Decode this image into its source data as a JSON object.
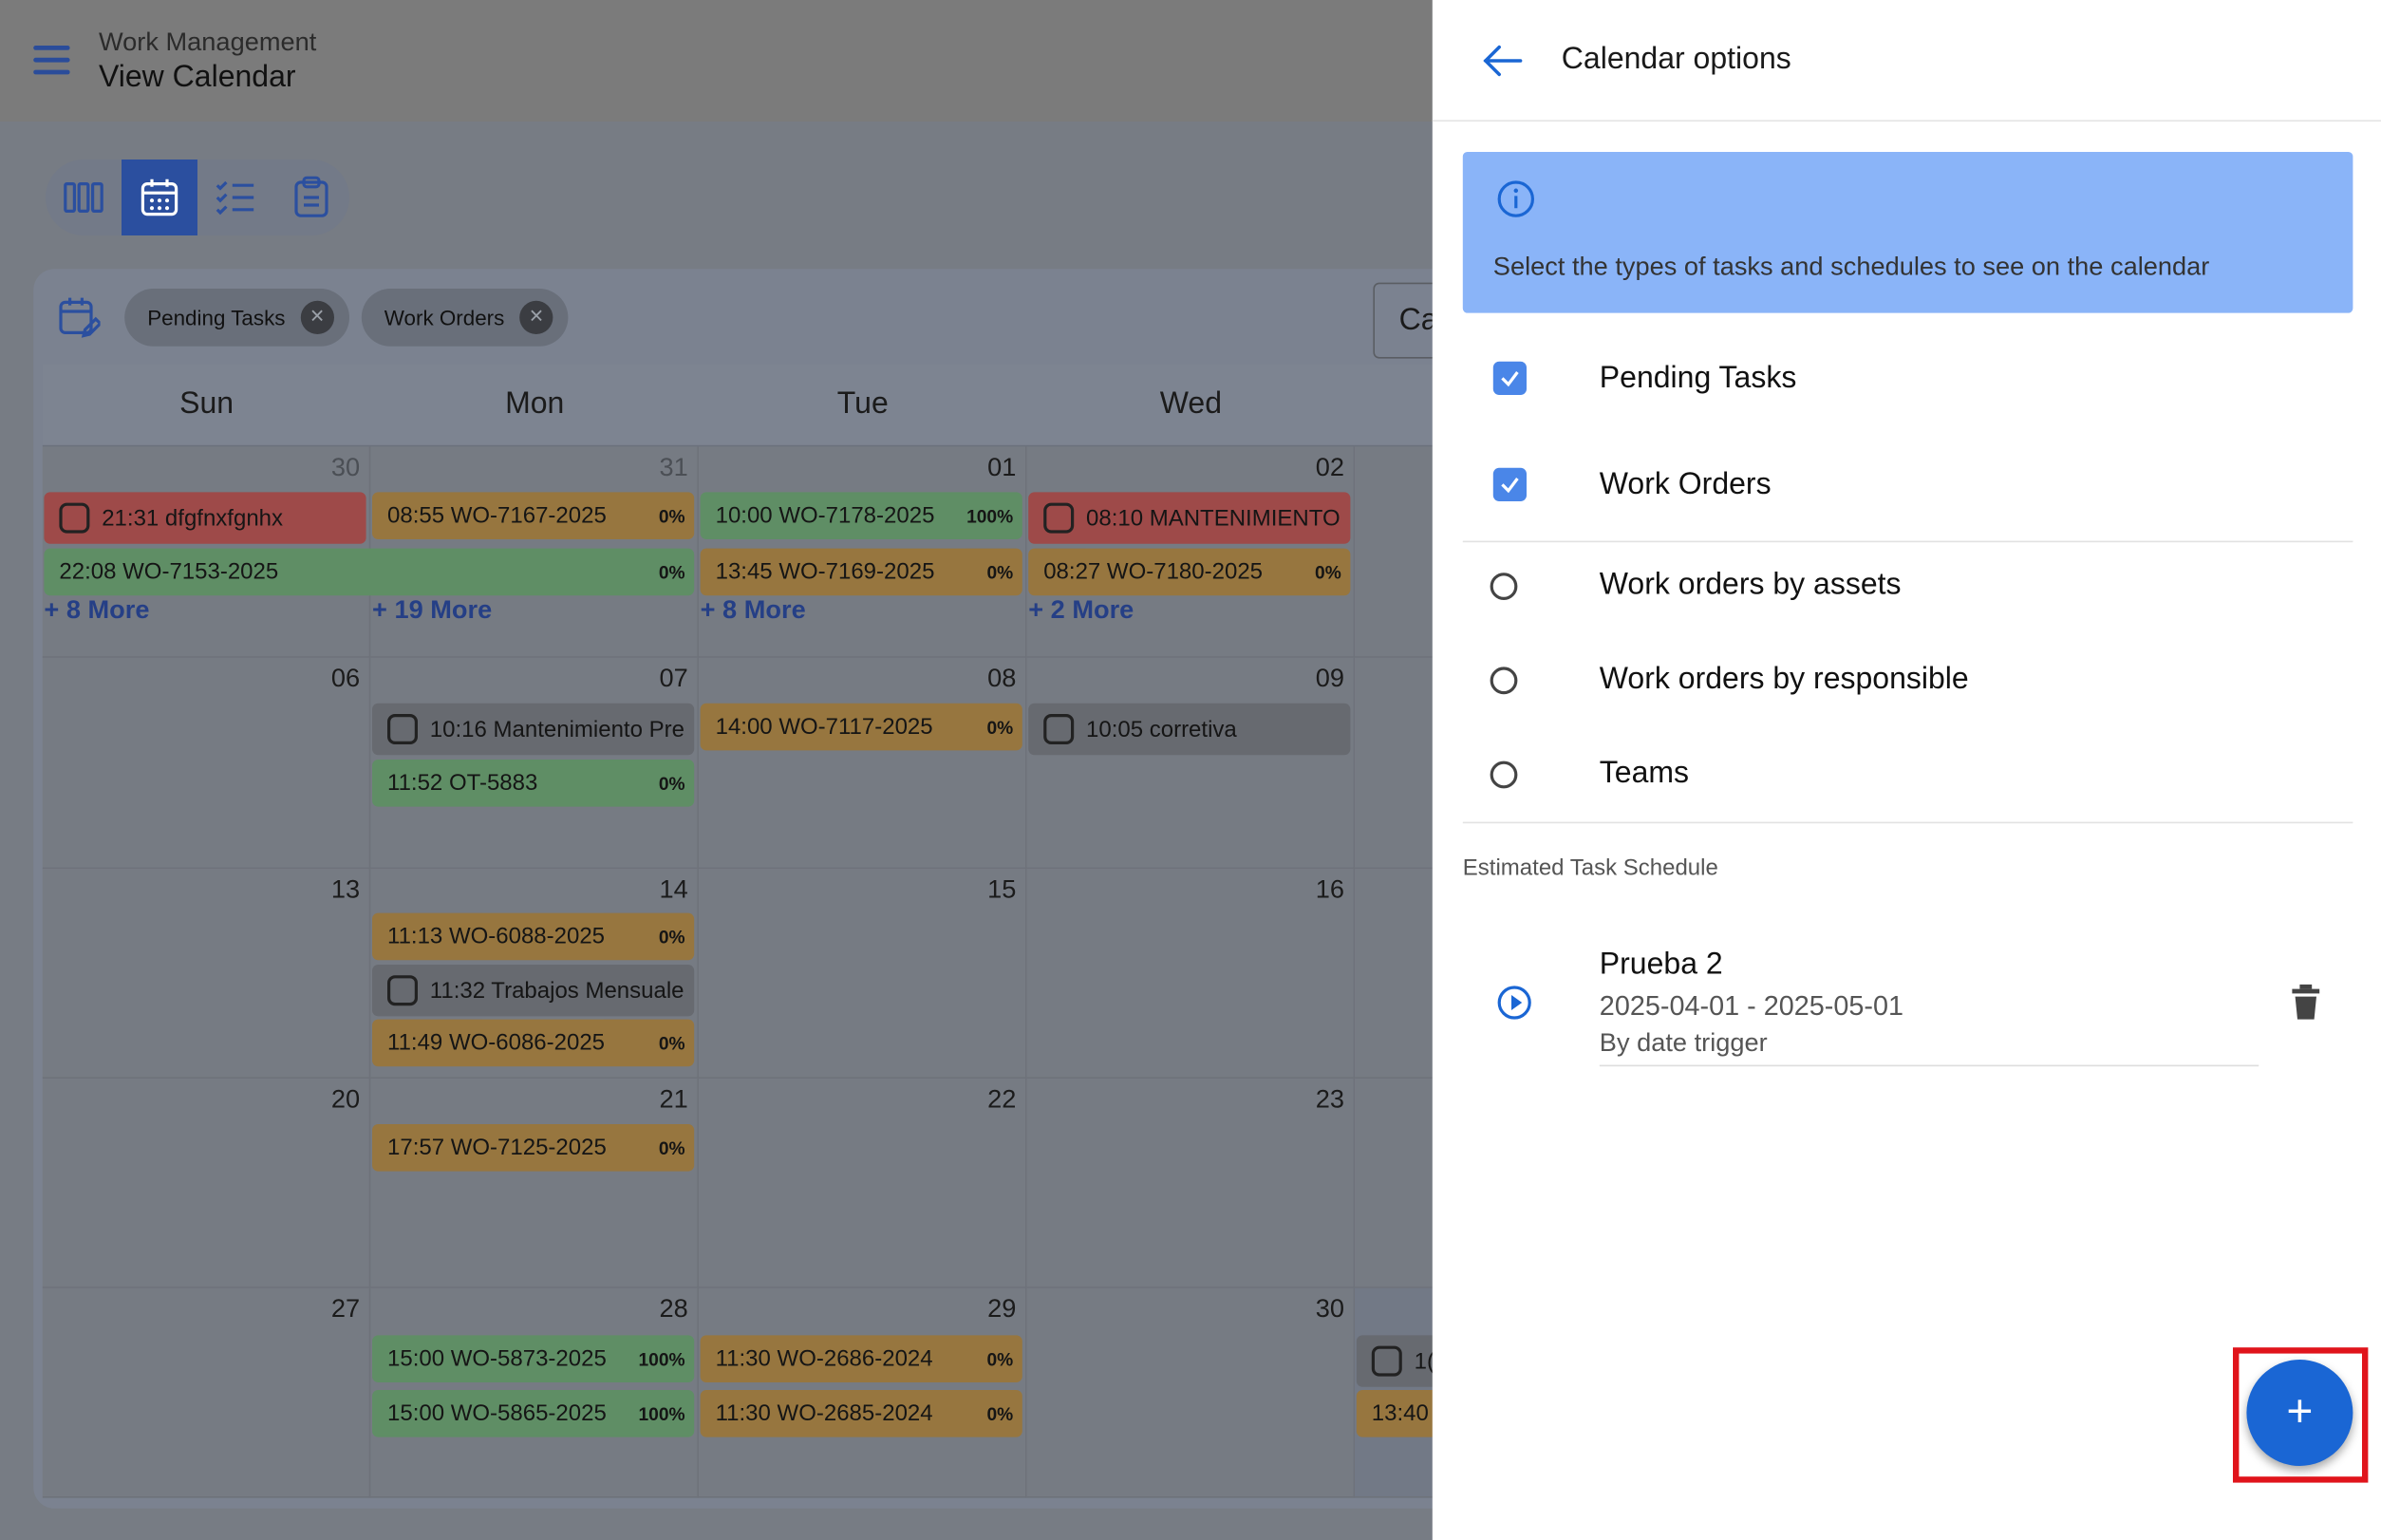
{
  "header": {
    "app": "Work Management",
    "page": "View Calendar"
  },
  "filters": {
    "chips": [
      "Pending Tasks",
      "Work Orders"
    ],
    "partial_button": "Ca"
  },
  "calendar": {
    "days": [
      "Sun",
      "Mon",
      "Tue",
      "Wed"
    ],
    "weeks": [
      [
        "30",
        "31",
        "01",
        "02"
      ],
      [
        "06",
        "07",
        "08",
        "09"
      ],
      [
        "13",
        "14",
        "15",
        "16"
      ],
      [
        "20",
        "21",
        "22",
        "23"
      ],
      [
        "27",
        "28",
        "29",
        "30"
      ]
    ],
    "events": {
      "w0_sun": {
        "e1": "21:31 dfgfnxfgnhx",
        "e2": "22:08 WO-7153-2025",
        "e2p": "0%",
        "more": "+ 8 More"
      },
      "w0_mon": {
        "e1": "08:55 WO-7167-2025",
        "e1p": "0%",
        "more": "+ 19 More"
      },
      "w0_tue": {
        "e1": "10:00 WO-7178-2025",
        "e1p": "100%",
        "e2": "13:45 WO-7169-2025",
        "e2p": "0%",
        "more": "+ 8 More"
      },
      "w0_wed": {
        "e1": "08:10 MANTENIMIENTO",
        "e2": "08:27 WO-7180-2025",
        "e2p": "0%",
        "more": "+ 2 More"
      },
      "w1_mon": {
        "e1": "10:16 Mantenimiento Pre",
        "e2": "11:52 OT-5883",
        "e2p": "0%"
      },
      "w1_tue": {
        "e1": "14:00 WO-7117-2025",
        "e1p": "0%"
      },
      "w1_wed": {
        "e1": "10:05 corretiva"
      },
      "w2_mon": {
        "e1": "11:13 WO-6088-2025",
        "e1p": "0%",
        "e2": "11:32 Trabajos Mensuale",
        "e3": "11:49 WO-6086-2025",
        "e3p": "0%"
      },
      "w3_mon": {
        "e1": "17:57 WO-7125-2025",
        "e1p": "0%"
      },
      "w4_mon": {
        "e1": "15:00 WO-5873-2025",
        "e1p": "100%",
        "e2": "15:00 WO-5865-2025",
        "e2p": "100%"
      },
      "w4_tue": {
        "e1": "11:30 WO-2686-2024",
        "e1p": "0%",
        "e2": "11:30 WO-2685-2024",
        "e2p": "0%"
      },
      "w4_thu": {
        "e1": "1(",
        "e2": "13:40"
      }
    }
  },
  "panel": {
    "title": "Calendar options",
    "info": "Select the types of tasks and schedules to see on the calendar",
    "checks": [
      {
        "label": "Pending Tasks",
        "checked": true
      },
      {
        "label": "Work Orders",
        "checked": true
      }
    ],
    "radios": [
      "Work orders by assets",
      "Work orders by responsible",
      "Teams"
    ],
    "section": "Estimated Task Schedule",
    "schedule": {
      "name": "Prueba 2",
      "dates": "2025-04-01 - 2025-05-01",
      "trigger": "By date trigger"
    },
    "fab": "+"
  },
  "colors": {
    "accent": "#1a66d4",
    "info_bg": "#8ab4f8",
    "checkbox": "#4a86e8",
    "highlight": "#e0141b"
  }
}
